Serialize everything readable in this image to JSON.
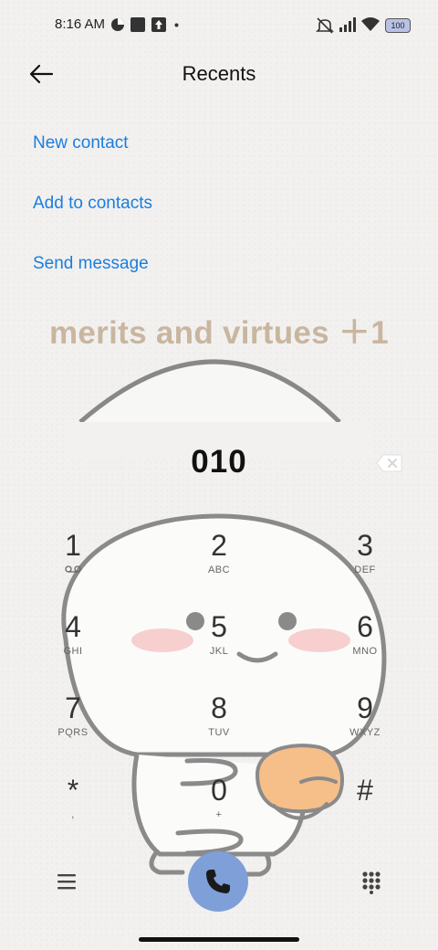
{
  "status_bar": {
    "time": "8:16 AM",
    "battery": "100",
    "icons": [
      "alarm-off-icon",
      "signal-icon",
      "wifi-icon",
      "battery-icon"
    ]
  },
  "header": {
    "title": "Recents",
    "back_icon": "arrow-left-icon"
  },
  "actions": [
    {
      "label": "New contact"
    },
    {
      "label": "Add to contacts"
    },
    {
      "label": "Send message"
    }
  ],
  "banner": {
    "text": "merits and virtues ＋1"
  },
  "dialer": {
    "number": "010",
    "keys": [
      {
        "digit": "1",
        "letters": ""
      },
      {
        "digit": "2",
        "letters": "ABC"
      },
      {
        "digit": "3",
        "letters": "DEF"
      },
      {
        "digit": "4",
        "letters": "GHI"
      },
      {
        "digit": "5",
        "letters": "JKL"
      },
      {
        "digit": "6",
        "letters": "MNO"
      },
      {
        "digit": "7",
        "letters": "PQRS"
      },
      {
        "digit": "8",
        "letters": "TUV"
      },
      {
        "digit": "9",
        "letters": "WXYZ"
      },
      {
        "digit": "*",
        "letters": ","
      },
      {
        "digit": "0",
        "letters": "+"
      },
      {
        "digit": "#",
        "letters": ""
      }
    ]
  },
  "colors": {
    "accent": "#1a7ee0",
    "call_button": "#7e9fd8",
    "banner": "#c9b6a0"
  }
}
